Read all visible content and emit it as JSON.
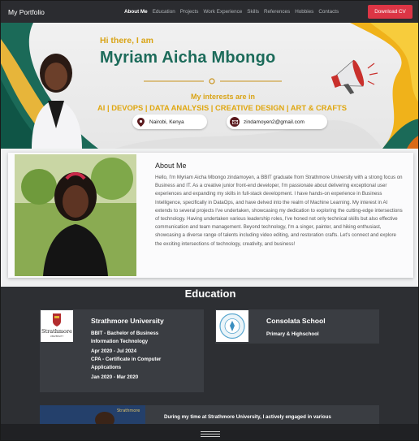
{
  "navbar": {
    "brand": "My Portfolio",
    "links": [
      "About Me",
      "Education",
      "Projects",
      "Work Experience",
      "Skills",
      "References",
      "Hobbies",
      "Contacts"
    ],
    "cta": "Download CV"
  },
  "hero": {
    "greeting": "Hi there, I am",
    "name": "Myriam Aicha Mbongo",
    "interests_title": "My interests are in",
    "interests": "AI | DEVOPS | DATA ANALYSIS | CREATIVE DESIGN | ART & CRAFTS",
    "location": "Nairobi, Kenya",
    "email": "zindamoyen2@gmail.com",
    "colors": {
      "green": "#1c6b5a",
      "gold": "#d9a416",
      "maroon": "#5a1a1e"
    }
  },
  "about": {
    "title": "About Me",
    "text": "Hello, I'm Myriam Aicha Mbongo zindamoyen, a BBIT graduate from Strathmore University with a strong focus on Business and IT. As a creative junior front-end developer, I'm passionate about delivering exceptional user experiences and expanding my skills in full-stack development. I have hands-on experience in Business Intelligence, specifically in DataOps, and have delved into the realm of Machine Learning. My interest in AI extends to several projects I've undertaken, showcasing my dedication to exploring the cutting-edge intersections of technology. Having undertaken various leadership roles, I've honed not only technical skills but also effective communication and team management. Beyond technology, I'm a singer, painter, and hiking enthusiast, showcasing a diverse range of talents including video editing, and restoration crafts. Let's connect and explore the exciting intersections of technology, creativity, and business!"
  },
  "education": {
    "title": "Education",
    "schools": [
      {
        "name": "Strathmore University",
        "logo_text": "Strathmore",
        "logo_subtext": "UNIVERSITY",
        "lines": [
          "BBIT - Bachelor of Business",
          "Information Technology",
          "Apr 2020 - Jul 2024",
          "CPA - Certificate in Computer",
          "Applications",
          "Jan 2020 - Mar 2020"
        ]
      },
      {
        "name": "Consolata School",
        "lines": [
          "Primary & Highschool"
        ]
      }
    ],
    "experience_snippet": "During my time at Strathmore University, I actively engaged in various",
    "experience_logo_text": "Strathmore"
  }
}
